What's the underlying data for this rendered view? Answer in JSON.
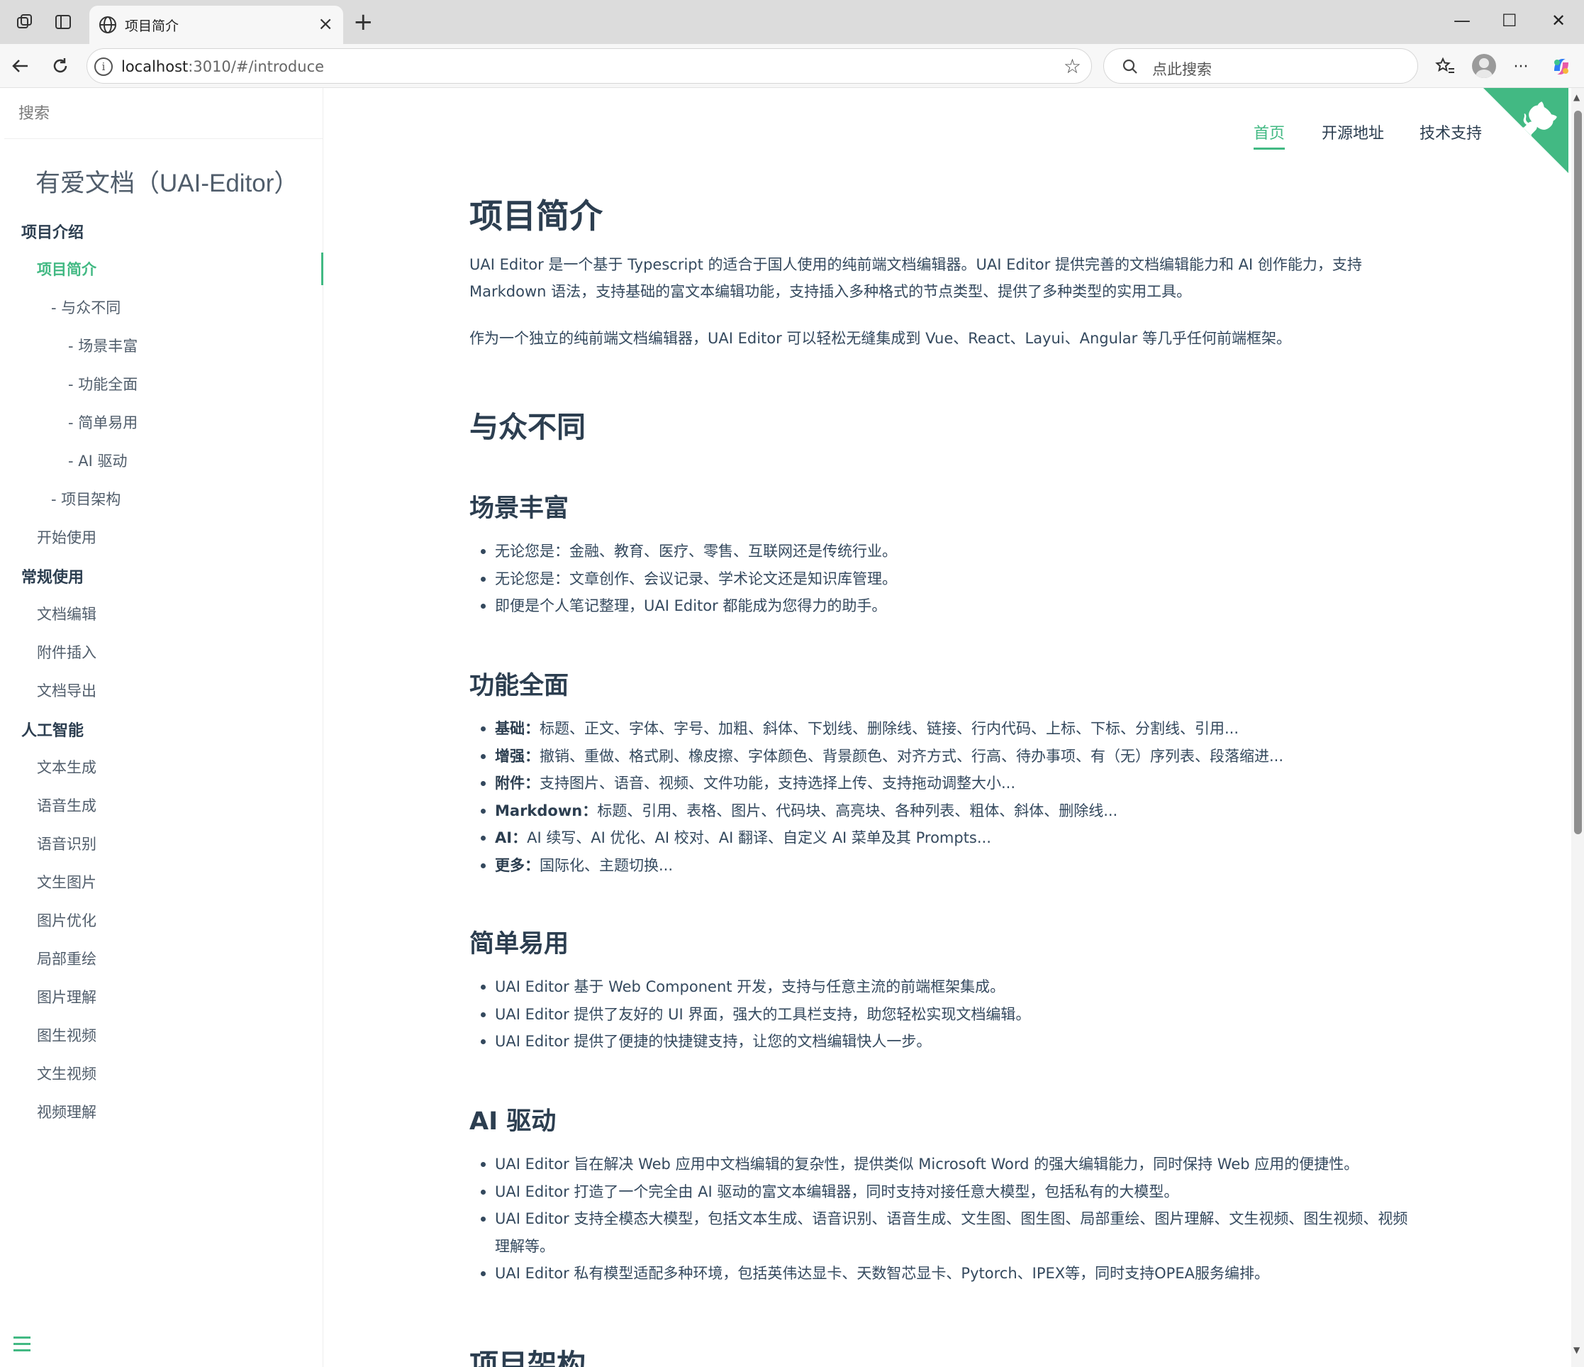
{
  "browser": {
    "tab_title": "项目简介",
    "tab_close": "×",
    "new_tab": "+",
    "url_host": "localhost",
    "url_rest": ":3010/#/introduce",
    "search_placeholder": "点此搜索",
    "more_label": "···",
    "win_min": "—",
    "win_max": "☐",
    "win_close": "✕"
  },
  "sidebar": {
    "search_placeholder": "搜索",
    "app_name": "有爱文档（UAI-Editor）",
    "items": [
      {
        "label": "项目介绍",
        "type": "group"
      },
      {
        "label": "项目简介",
        "type": "item",
        "active": true
      },
      {
        "label": "- 与众不同",
        "type": "sub"
      },
      {
        "label": "- 场景丰富",
        "type": "subsub"
      },
      {
        "label": "- 功能全面",
        "type": "subsub"
      },
      {
        "label": "- 简单易用",
        "type": "subsub"
      },
      {
        "label": "- AI 驱动",
        "type": "subsub"
      },
      {
        "label": "- 项目架构",
        "type": "sub"
      },
      {
        "label": "开始使用",
        "type": "item"
      },
      {
        "label": "常规使用",
        "type": "group"
      },
      {
        "label": "文档编辑",
        "type": "item"
      },
      {
        "label": "附件插入",
        "type": "item"
      },
      {
        "label": "文档导出",
        "type": "item"
      },
      {
        "label": "人工智能",
        "type": "group"
      },
      {
        "label": "文本生成",
        "type": "item"
      },
      {
        "label": "语音生成",
        "type": "item"
      },
      {
        "label": "语音识别",
        "type": "item"
      },
      {
        "label": "文生图片",
        "type": "item"
      },
      {
        "label": "图片优化",
        "type": "item"
      },
      {
        "label": "局部重绘",
        "type": "item"
      },
      {
        "label": "图片理解",
        "type": "item"
      },
      {
        "label": "图生视频",
        "type": "item"
      },
      {
        "label": "文生视频",
        "type": "item"
      },
      {
        "label": "视频理解",
        "type": "item"
      }
    ]
  },
  "topnav": {
    "home": "首页",
    "opensource": "开源地址",
    "support": "技术支持"
  },
  "content": {
    "title": "项目简介",
    "intro_p1": "UAI Editor 是一个基于 Typescript 的适合于国人使用的纯前端文档编辑器。UAI Editor 提供完善的文档编辑能力和 AI 创作能力，支持 Markdown 语法，支持基础的富文本编辑功能，支持插入多种格式的节点类型、提供了多种类型的实用工具。",
    "intro_p2": "作为一个独立的纯前端文档编辑器，UAI Editor 可以轻松无缝集成到 Vue、React、Layui、Angular 等几乎任何前端框架。",
    "h2_diff": "与众不同",
    "h3_scene": "场景丰富",
    "scene_items": [
      "无论您是：金融、教育、医疗、零售、互联网还是传统行业。",
      "无论您是：文章创作、会议记录、学术论文还是知识库管理。",
      "即便是个人笔记整理，UAI Editor 都能成为您得力的助手。"
    ],
    "h3_features": "功能全面",
    "feature_items": [
      {
        "label": "基础：",
        "text": "标题、正文、字体、字号、加粗、斜体、下划线、删除线、链接、行内代码、上标、下标、分割线、引用..."
      },
      {
        "label": "增强：",
        "text": "撤销、重做、格式刷、橡皮擦、字体颜色、背景颜色、对齐方式、行高、待办事项、有（无）序列表、段落缩进..."
      },
      {
        "label": "附件：",
        "text": "支持图片、语音、视频、文件功能，支持选择上传、支持拖动调整大小..."
      },
      {
        "label": "Markdown：",
        "text": "标题、引用、表格、图片、代码块、高亮块、各种列表、粗体、斜体、删除线..."
      },
      {
        "label": "AI：",
        "text": "AI 续写、AI 优化、AI 校对、AI 翻译、自定义 AI 菜单及其 Prompts..."
      },
      {
        "label": "更多：",
        "text": "国际化、主题切换..."
      }
    ],
    "h3_easy": "简单易用",
    "easy_items": [
      "UAI Editor 基于 Web Component 开发，支持与任意主流的前端框架集成。",
      "UAI Editor 提供了友好的 UI 界面，强大的工具栏支持，助您轻松实现文档编辑。",
      "UAI Editor 提供了便捷的快捷键支持，让您的文档编辑快人一步。"
    ],
    "h3_ai": "AI 驱动",
    "ai_items": [
      "UAI Editor 旨在解决 Web 应用中文档编辑的复杂性，提供类似 Microsoft Word 的强大编辑能力，同时保持 Web 应用的便捷性。",
      "UAI Editor 打造了一个完全由 AI 驱动的富文本编辑器，同时支持对接任意大模型，包括私有的大模型。",
      "UAI Editor 支持全模态大模型，包括文本生成、语音识别、语音生成、文生图、图生图、局部重绘、图片理解、文生视频、图生视频、视频理解等。",
      "UAI Editor 私有模型适配多种环境，包括英伟达显卡、天数智芯显卡、Pytorch、IPEX等，同时支持OPEA服务编排。"
    ],
    "h2_arch": "项目架构"
  },
  "colors": {
    "accent": "#42b983",
    "text": "#34495e",
    "heading": "#2c3e50"
  }
}
